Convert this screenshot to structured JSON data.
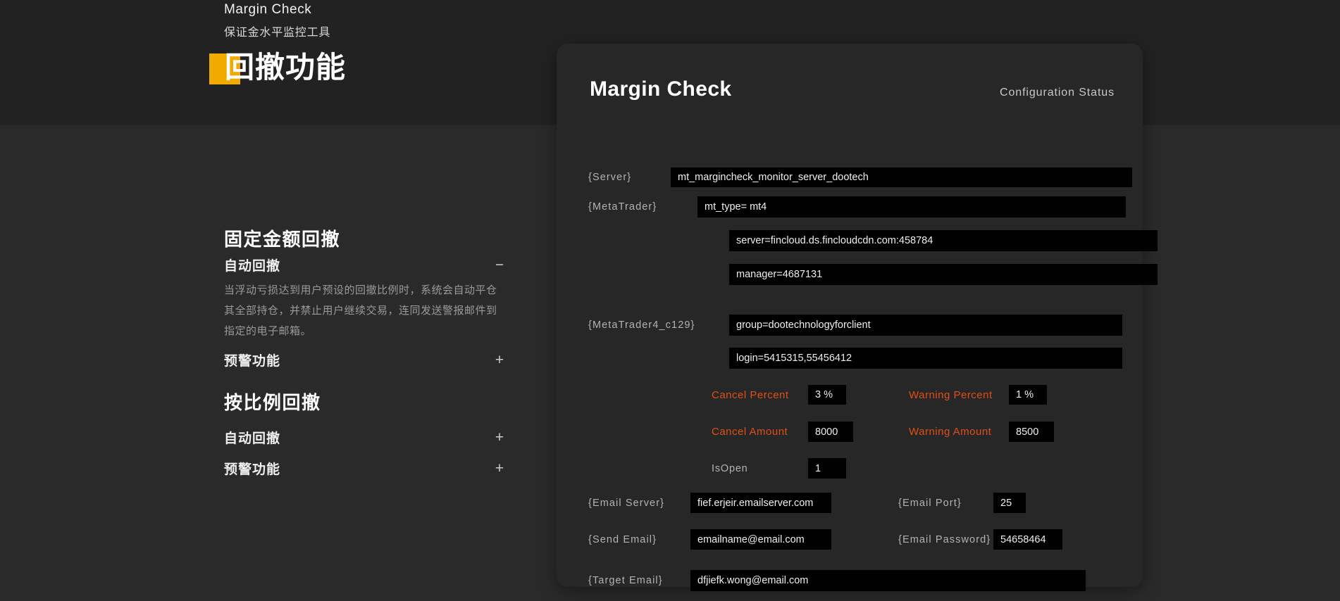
{
  "brand": {
    "title": "Margin Check",
    "subtitle": "保证金水平监控工具",
    "logo_text": "回撤功能",
    "accent_yellow": "#f2a900"
  },
  "left_panel": {
    "sections": [
      {
        "title": "固定金额回撤",
        "items": [
          {
            "label": "自动回撤",
            "sign": "−",
            "expanded": true,
            "description": "当浮动亏损达到用户预设的回撤比例时，系统会自动平仓其全部持仓，并禁止用户继续交易，连同发送警报邮件到指定的电子邮箱。"
          },
          {
            "label": "预警功能",
            "sign": "+",
            "expanded": false
          }
        ]
      },
      {
        "title": "按比例回撤",
        "items": [
          {
            "label": "自动回撤",
            "sign": "+",
            "expanded": false
          },
          {
            "label": "预警功能",
            "sign": "+",
            "expanded": false
          }
        ]
      }
    ]
  },
  "card": {
    "title": "Margin Check",
    "status": "Configuration Status",
    "accent_orange": "#de4f19",
    "fields": {
      "server_label": "{Server}",
      "server_value": "mt_margincheck_monitor_server_dootech",
      "metatrader_label": "{MetaTrader}",
      "mt_type": "mt_type= mt4",
      "mt_server": "server=fincloud.ds.fincloudcdn.com:458784",
      "mt_manager": "manager=4687131",
      "mt4c129_label": "{MetaTrader4_c129}",
      "mt4_group": "group=dootechnologyforclient",
      "mt4_login": "login=5415315,55456412",
      "cancel_percent_label": "Cancel Percent",
      "cancel_percent_value": "3 %",
      "warning_percent_label": "Warning Percent",
      "warning_percent_value": "1 %",
      "cancel_amount_label": "Cancel Amount",
      "cancel_amount_value": "8000",
      "warning_amount_label": "Warning Amount",
      "warning_amount_value": "8500",
      "isopen_label": "IsOpen",
      "isopen_value": "1",
      "email_server_label": "{Email Server}",
      "email_server_value": "fief.erjeir.emailserver.com",
      "email_port_label": "{Email Port}",
      "email_port_value": "25",
      "send_email_label": "{Send Email}",
      "send_email_value": "emailname@email.com",
      "email_password_label": "{Email Password}",
      "email_password_value": "54658464",
      "target_email_label": "{Target Email}",
      "target_email_value": "dfjiefk.wong@email.com"
    }
  }
}
